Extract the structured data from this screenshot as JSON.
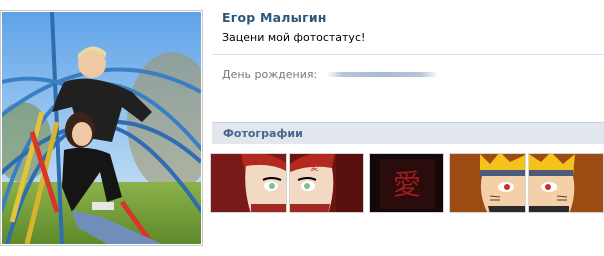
{
  "profile": {
    "name": "Егор Малыгин",
    "status": "Зацени мой фотостатус!",
    "birthday_label": "День рождения:",
    "birthday_value": ""
  },
  "photos": {
    "header": "Фотографии",
    "items": [
      {
        "name": "photo-gaara-1"
      },
      {
        "name": "photo-gaara-2"
      },
      {
        "name": "photo-kanji"
      },
      {
        "name": "photo-naruto-1"
      },
      {
        "name": "photo-naruto-2"
      }
    ]
  },
  "colors": {
    "name_link": "#2b587a",
    "header_bg": "#e1e7ed",
    "header_text": "#45688e",
    "divider": "#dae1e8"
  }
}
